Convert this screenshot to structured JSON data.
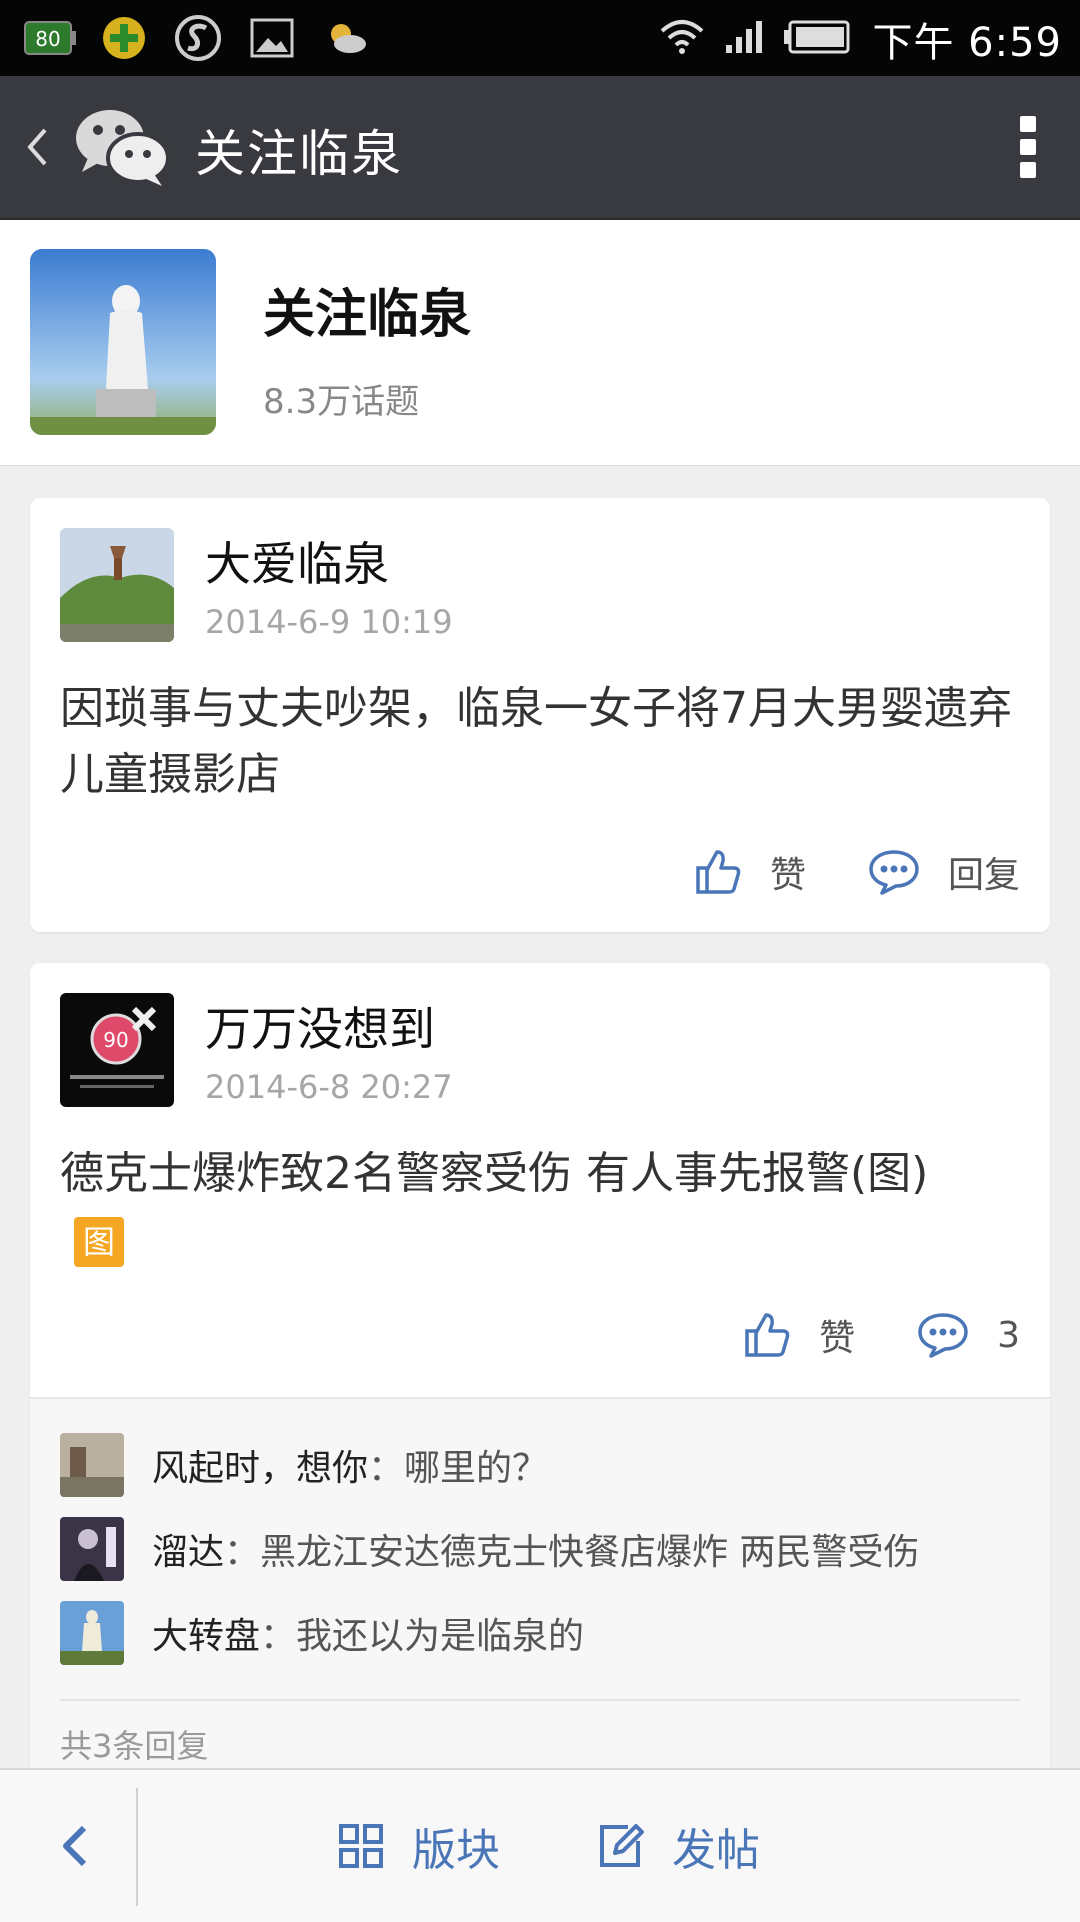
{
  "status_bar": {
    "time": "下午 6:59",
    "battery_icon_text": "80",
    "icons": [
      "battery-icon",
      "360-security-icon",
      "s-app-icon",
      "gallery-icon",
      "weather-icon",
      "wifi-icon",
      "signal-icon",
      "battery-level-icon"
    ]
  },
  "title_bar": {
    "title": "关注临泉",
    "icons": [
      "back-icon",
      "wechat-logo-icon",
      "more-icon"
    ]
  },
  "header": {
    "name": "关注临泉",
    "subtitle": "8.3万话题"
  },
  "posts": [
    {
      "author": "大爱临泉",
      "time": "2014-6-9 10:19",
      "text": "因琐事与丈夫吵架，临泉一女子将7月大男婴遗弃儿童摄影店",
      "like_label": "赞",
      "reply_label": "回复"
    },
    {
      "author": "万万没想到",
      "time": "2014-6-8 20:27",
      "text": "德克士爆炸致2名警察受伤 有人事先报警(图)",
      "badge": "图",
      "like_label": "赞",
      "reply_label": "3",
      "avatar_text": "90",
      "replies": [
        {
          "name": "风起时，想你",
          "sep": "：",
          "content": "哪里的？"
        },
        {
          "name": "溜达",
          "sep": "：",
          "content": "黑龙江安达德克士快餐店爆炸 两民警受伤"
        },
        {
          "name": "大转盘",
          "sep": "：",
          "content": "我还以为是临泉的"
        }
      ],
      "reply_count": "共3条回复"
    }
  ],
  "bottom_bar": {
    "section_label": "版块",
    "post_label": "发帖"
  },
  "colors": {
    "title_bar_bg": "#393a3f",
    "accent_blue": "#4a76b8",
    "badge_orange": "#f5a623"
  }
}
